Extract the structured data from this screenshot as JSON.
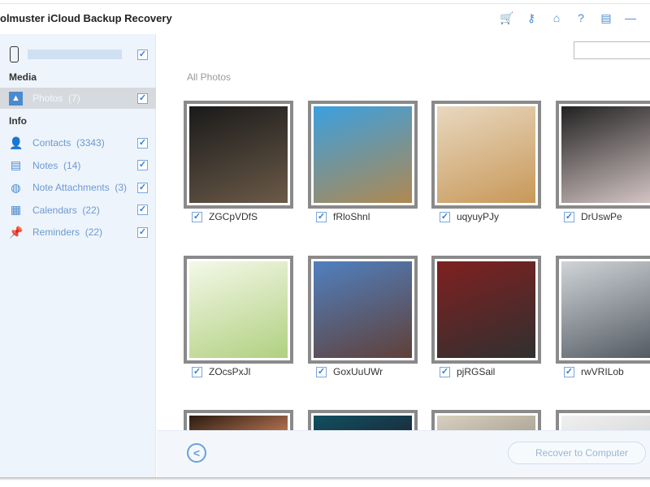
{
  "app": {
    "title": "olmuster iCloud Backup Recovery"
  },
  "toolbar": [
    {
      "icon": "cart-icon",
      "glyph": "🛒"
    },
    {
      "icon": "key-icon",
      "glyph": "⚷"
    },
    {
      "icon": "home-icon",
      "glyph": "⌂"
    },
    {
      "icon": "help-icon",
      "glyph": "?"
    },
    {
      "icon": "feedback-icon",
      "glyph": "▤"
    },
    {
      "icon": "minimize-icon",
      "glyph": "—"
    }
  ],
  "sidebar": {
    "media_heading": "Media",
    "info_heading": "Info",
    "photos": {
      "label": "Photos",
      "count": "(7)"
    },
    "items": [
      {
        "label": "Contacts",
        "count": "(3343)",
        "icon": "contacts-icon",
        "glyph": "👤"
      },
      {
        "label": "Notes",
        "count": "(14)",
        "icon": "notes-icon",
        "glyph": "▤"
      },
      {
        "label": "Note Attachments",
        "count": "(3)",
        "icon": "attachment-icon",
        "glyph": "◍"
      },
      {
        "label": "Calendars",
        "count": "(22)",
        "icon": "calendar-icon",
        "glyph": "▦"
      },
      {
        "label": "Reminders",
        "count": "(22)",
        "icon": "pin-icon",
        "glyph": "📌"
      }
    ]
  },
  "main": {
    "heading": "All Photos",
    "search_value": "",
    "photos": [
      {
        "name": "ZGCpVDfS",
        "colors": [
          "#1a1a1a",
          "#6b5a48"
        ]
      },
      {
        "name": "fRloShnl",
        "colors": [
          "#3aa0e0",
          "#b08850"
        ]
      },
      {
        "name": "uqyuyPJy",
        "colors": [
          "#e8d8c0",
          "#c89858"
        ]
      },
      {
        "name": "DrUswPe",
        "colors": [
          "#222",
          "#d8c8c8"
        ]
      },
      {
        "name": "ZOcsPxJl",
        "colors": [
          "#f4f8e8",
          "#b0d080"
        ]
      },
      {
        "name": "GoxUuUWr",
        "colors": [
          "#5080c0",
          "#604038"
        ]
      },
      {
        "name": "pjRGSail",
        "colors": [
          "#802020",
          "#303030"
        ]
      },
      {
        "name": "rwVRILob",
        "colors": [
          "#d0d4d8",
          "#505860"
        ]
      },
      {
        "name": "",
        "colors": [
          "#2a1a10",
          "#b07050"
        ]
      },
      {
        "name": "",
        "colors": [
          "#105060",
          "#1a3040"
        ]
      },
      {
        "name": "",
        "colors": [
          "#d8d0c0",
          "#b0a898"
        ]
      },
      {
        "name": "",
        "colors": [
          "#f0f0f0",
          "#dcdcdc"
        ]
      }
    ]
  },
  "footer": {
    "recover_label": "Recover to Computer"
  },
  "checkmark": "✓"
}
